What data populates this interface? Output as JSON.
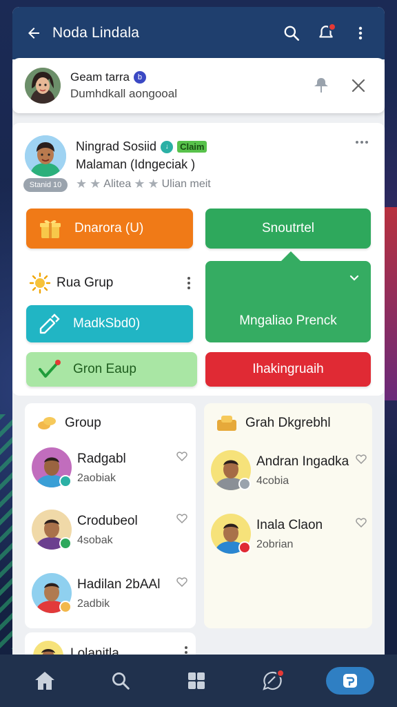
{
  "topbar": {
    "title": "Noda Lindala",
    "back_icon": "arrow-left-icon",
    "search_icon": "search-icon",
    "notification_icon": "bell-icon",
    "more_icon": "more-vert-icon"
  },
  "notification": {
    "name": "Geam tarra",
    "verified_mark": "b",
    "subtitle": "Dumhdkall aongooal"
  },
  "profile": {
    "name": "Ningrad Sosiid",
    "status_mark": "↓",
    "claim_label": "Claim",
    "handle": "Malaman (Idngeciak     )",
    "tag": "Stanid 10",
    "rating_text_1": "Alitea",
    "rating_text_2": "Ulian meit"
  },
  "actions": {
    "orange_label": "Dnarora (U)",
    "green_label": "Snoutrtel",
    "green_panel_label": "Mngaliao Prenck",
    "group_label": "Rua Grup",
    "teal_label": "MadkSbd0)",
    "lightgreen_label": "Gron Eaup",
    "red_label": "Ihakingruaih"
  },
  "groups_left": {
    "header": "Group",
    "items": [
      {
        "name": "Radgabl",
        "meta": "2aobiak"
      },
      {
        "name": "Crodubeol",
        "meta": "4sobak"
      },
      {
        "name": "Hadilan 2bAAl",
        "meta": "2adbik"
      }
    ]
  },
  "groups_right": {
    "header": "Grah Dkgrebhl",
    "items": [
      {
        "name": "Andran Ingadka",
        "meta": "4cobia"
      },
      {
        "name": "Inala Claon",
        "meta": "2obrian"
      }
    ]
  },
  "small_card": {
    "name": "Lolanitla"
  },
  "bottom_nav": {
    "items": [
      "home-icon",
      "search-icon",
      "grid-icon",
      "chat-icon",
      "profile-icon"
    ],
    "active_index": 4
  },
  "colors": {
    "topbar": "#1f3f6e",
    "orange": "#f07a17",
    "green": "#2ea85c",
    "teal": "#21b5c4",
    "lightgreen": "#a9e6a4",
    "red": "#e02a34",
    "nav_active": "#2f7fc3"
  }
}
